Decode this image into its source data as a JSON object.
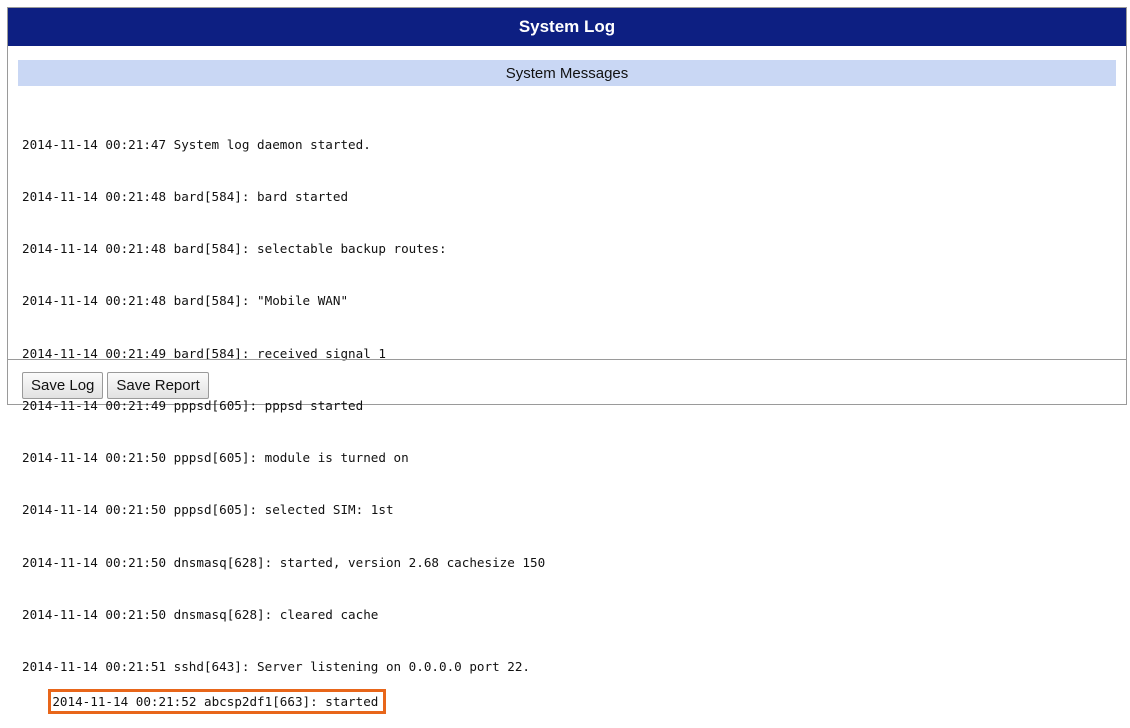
{
  "window": {
    "title": "System Log",
    "section_title": "System Messages"
  },
  "log": {
    "lines": [
      "2014-11-14 00:21:47 System log daemon started.",
      "2014-11-14 00:21:48 bard[584]: bard started",
      "2014-11-14 00:21:48 bard[584]: selectable backup routes:",
      "2014-11-14 00:21:48 bard[584]: \"Mobile WAN\"",
      "2014-11-14 00:21:49 bard[584]: received signal 1",
      "2014-11-14 00:21:49 pppsd[605]: pppsd started",
      "2014-11-14 00:21:50 pppsd[605]: module is turned on",
      "2014-11-14 00:21:50 pppsd[605]: selected SIM: 1st",
      "2014-11-14 00:21:50 dnsmasq[628]: started, version 2.68 cachesize 150",
      "2014-11-14 00:21:50 dnsmasq[628]: cleared cache",
      "2014-11-14 00:21:51 sshd[643]: Server listening on 0.0.0.0 port 22.",
      "2014-11-14 00:21:52 abcsp2df1[663]: started"
    ],
    "highlight_color": "#e8661a"
  },
  "buttons": {
    "save_log": "Save Log",
    "save_report": "Save Report"
  },
  "colors": {
    "title_bar": "#0d1f82",
    "section_header": "#c9d7f4"
  }
}
